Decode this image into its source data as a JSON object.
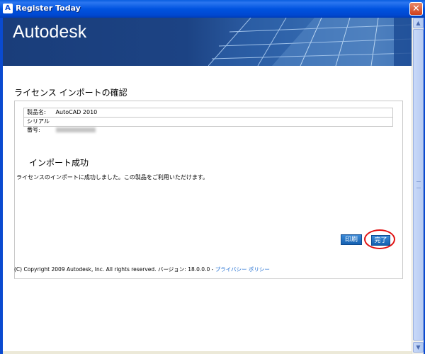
{
  "window": {
    "title": "Register Today",
    "close_glyph": "✕",
    "app_icon_glyph": "A"
  },
  "banner": {
    "logo": "Autodesk"
  },
  "page": {
    "title": "ライセンス インポートの確認"
  },
  "product_info": {
    "product_label": "製品名:",
    "product_value": "AutoCAD 2010",
    "serial_label": "シリアル番号:"
  },
  "result": {
    "title": "インポート成功",
    "message": "ライセンスのインポートに成功しました。この製品をご利用いただけます。"
  },
  "buttons": {
    "print": "印刷",
    "done": "完了"
  },
  "footer": {
    "copyright": "(C) Copyright 2009 Autodesk, Inc. All rights reserved. バージョン: 18.0.0.0 - ",
    "privacy_link": "プライバシー ポリシー"
  },
  "scrollbar": {
    "up_glyph": "▲",
    "down_glyph": "▼"
  },
  "colors": {
    "titlebar": "#0053e0",
    "banner": "#1c4384",
    "highlight": "#e01010",
    "link": "#1a6ad0"
  }
}
